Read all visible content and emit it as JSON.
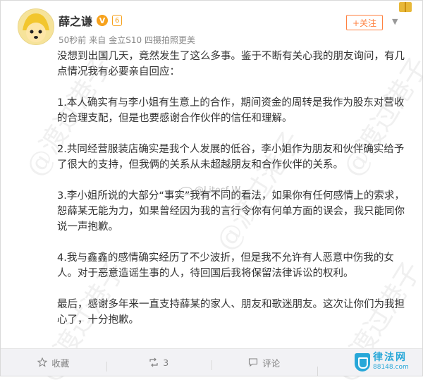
{
  "post": {
    "author": "薛之谦",
    "verified_badge": "V",
    "level_badge": "6",
    "time": "50秒前",
    "source_prefix": "来自",
    "source": "金立S10 四摄拍照更美",
    "follow_label": "+关注",
    "paragraphs": [
      "没想到出国几天，竟然发生了这么多事。鉴于不断有关心我的朋友询问，有几点情况我有必要亲自回应：",
      "1.本人确实有与李小姐有生意上的合作，期间资金的周转是我作为股东对营收的合理支配，但是也要感谢合作伙伴的信任和理解。",
      "2.共同经营服装店确实是我个人发展的低谷，李小姐作为朋友和伙伴确实给予了很大的支持，但我俩的关系从未超越朋友和合作伙伴的关系。",
      "3.李小姐所说的大部分“事实”我有不同的看法，如果你有任何感情上的索求，恕薛某无能为力，如果曾经因为我的言行令你有何单方面的误会，我只能同你说一声抱歉。",
      "4.我与鑫鑫的感情确实经历了不少波折，但是我不允许有人恶意中伤我的女人。对于恶意造谣生事的人，待回国后我将保留法律诉讼的权利。",
      "最后，感谢多年来一直支持薛某的家人、朋友和歌迷朋友。这次让你们为我担心了，十分抱歉。"
    ]
  },
  "footer": {
    "favorite_label": "收藏",
    "repost_count": "3",
    "comment_label": "评论"
  },
  "watermark": {
    "text": "@渡过港子",
    "handle": "@Litosf W"
  },
  "site": {
    "name": "律法网",
    "url": "88148.com"
  },
  "colors": {
    "accent": "#ff8140",
    "badge": "#f7a21c",
    "site": "#27a7d8"
  }
}
